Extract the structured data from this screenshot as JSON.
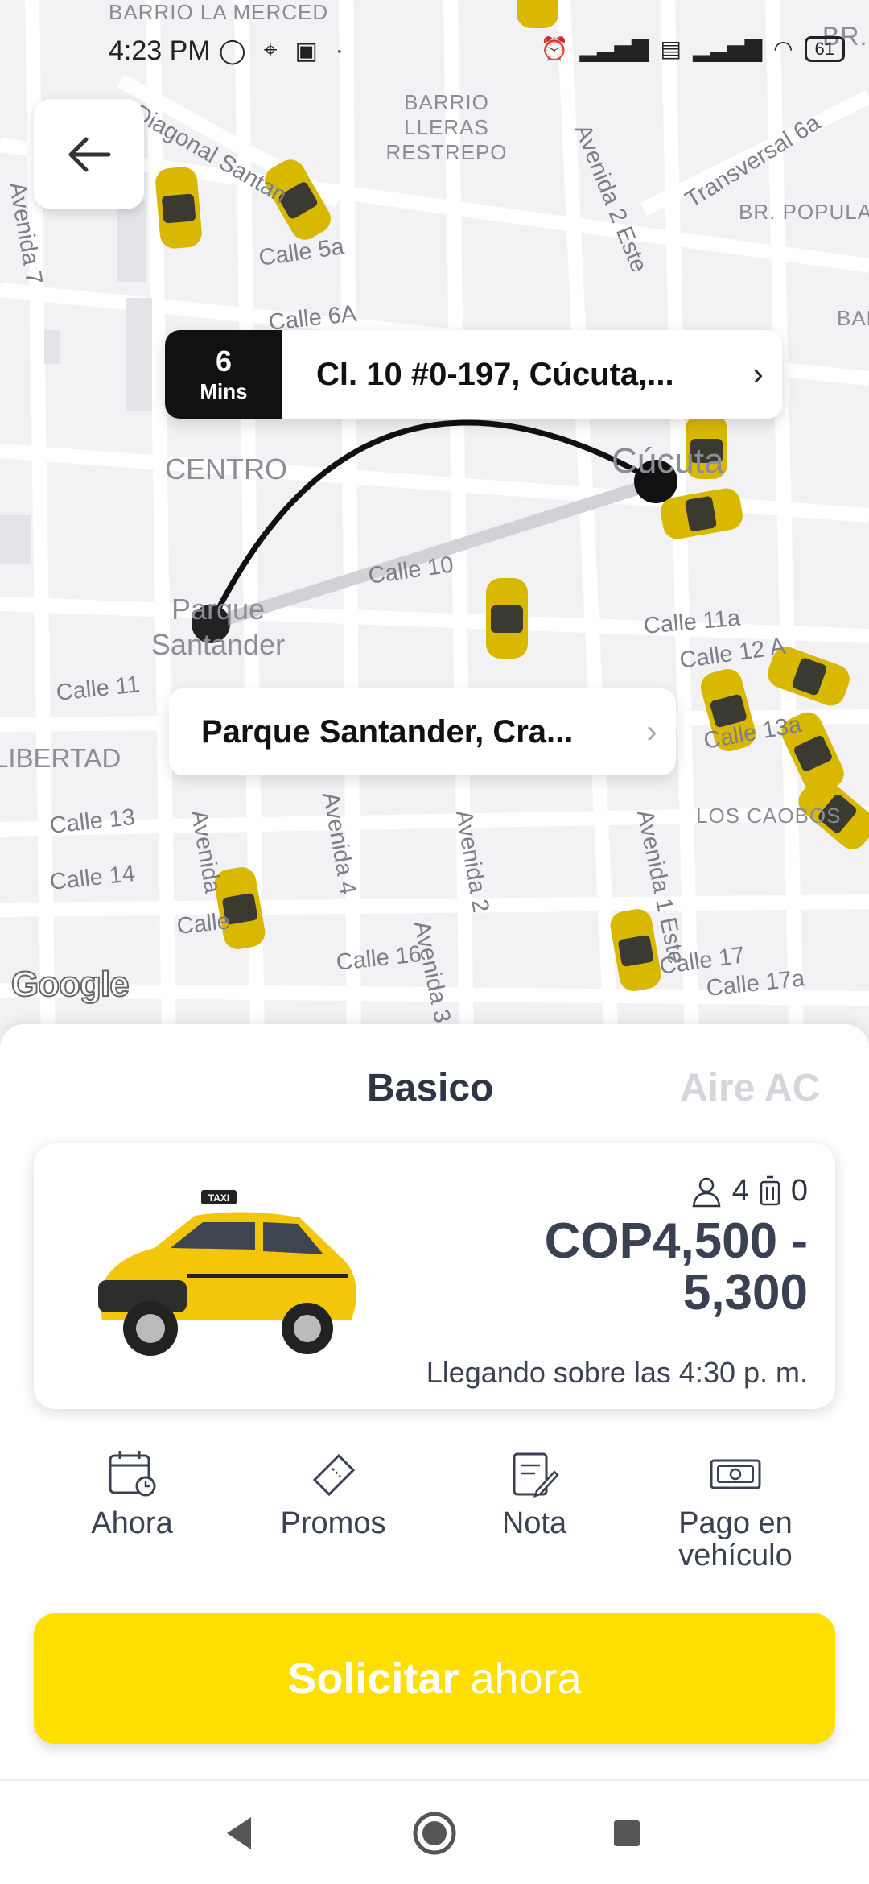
{
  "status_bar": {
    "time": "4:23 PM",
    "battery": "61"
  },
  "map": {
    "districts": [
      "BARRIO LA MERCED",
      "BARRIO LLERAS RESTREPO",
      "BR. POPULAR",
      "CENTRO",
      "Cúcuta",
      "Parque Santander",
      "LIBERTAD",
      "LOS CAOBOS",
      "BR. E",
      "BAR"
    ],
    "streets": [
      "Diagonal Santan",
      "Calle 5a",
      "Calle 6A",
      "Avenida 7",
      "Avenida 2 Este",
      "Transversal 6a",
      "Calle 10",
      "Calle 11a",
      "Calle 12 A",
      "Calle 13a",
      "Calle 11",
      "Calle 13",
      "Calle 14",
      "Avenida 4",
      "Avenida 2",
      "Avenida 1 Este",
      "Calle 16",
      "Avenida 3",
      "Calle 17",
      "Calle 17a",
      "Calle",
      "Avenida"
    ],
    "google": "Google"
  },
  "destination": {
    "eta_value": "6",
    "eta_unit": "Mins",
    "address": "Cl. 10 #0-197, Cúcuta,..."
  },
  "origin": {
    "address": "Parque Santander, Cra..."
  },
  "tabs": [
    "Basico",
    "Aire AC"
  ],
  "ride_card": {
    "passengers": "4",
    "luggage": "0",
    "price_line1": "COP4,500 -",
    "price_line2": "5,300",
    "arrival": "Llegando sobre las 4:30 p. m.",
    "taxi_sign": "TAXI"
  },
  "options": [
    "Ahora",
    "Promos",
    "Nota",
    "Pago en vehículo"
  ],
  "cta": {
    "bold": "Solicitar",
    "rest": "ahora"
  },
  "colors": {
    "accent": "#ffdf00",
    "taxi": "#e8c400",
    "text": "#2f3547"
  },
  "icons": [
    "back-arrow-icon",
    "calendar-icon",
    "ticket-icon",
    "note-icon",
    "cash-icon",
    "person-icon",
    "luggage-icon"
  ]
}
